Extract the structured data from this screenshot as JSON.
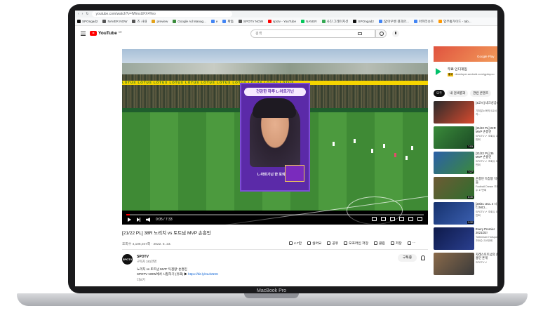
{
  "browser": {
    "url": "youtube.com/watch?v=fWmxUFX4Yeo",
    "bookmarks": [
      {
        "label": "SPOngad2",
        "color": "#111111"
      },
      {
        "label": "NAVER NOW",
        "color": "#555555"
      },
      {
        "label": "즈 사내",
        "color": "#555555"
      },
      {
        "label": "preview",
        "color": "#e3a21a"
      },
      {
        "label": "Google Ad Manag...",
        "color": "#3a8b3a"
      },
      {
        "label": "e",
        "color": "#4285f4"
      },
      {
        "label": "확돔",
        "color": "#4285f4"
      },
      {
        "label": "SPOTV NOW",
        "color": "#555555"
      },
      {
        "label": "spotv - YouTube",
        "color": "#ff0000"
      },
      {
        "label": "NAVER",
        "color": "#03c75a"
      },
      {
        "label": "사진 그레이지션",
        "color": "#34a853"
      },
      {
        "label": "SPOngad2",
        "color": "#111111"
      },
      {
        "label": "[압아우벤 결과안...",
        "color": "#4285f4"
      },
      {
        "label": "아파리슈즈",
        "color": "#4285f4"
      },
      {
        "label": "업무통가이드 - tab...",
        "color": "#ff9800"
      }
    ]
  },
  "youtube": {
    "logo_text": "YouTube",
    "logo_country": "KR",
    "search_placeholder": "검색"
  },
  "video": {
    "board_text": "LOTUS LOTUS LOTUS LOTUS LOTUS LOTUS LOTUS LOTUS LOTUS LOTUS LOTUS",
    "ad_headline": "건강한 하루 L-아르기닌",
    "ad_tagline": "L-아르기닌 한 포의 가치",
    "time_display": "0:05 / 7:33",
    "progress_fraction": 0.012,
    "title": "[21/22 PL] 38R 노리치 vs 토트넘 MVP 손흥민",
    "meta": "조회수 4,106,047회 · 2022. 5. 23.",
    "actions": [
      {
        "label": "4.7만",
        "icon": "thumbs-up-icon"
      },
      {
        "label": "싫어요",
        "icon": "thumbs-down-icon"
      },
      {
        "label": "공유",
        "icon": "share-icon"
      },
      {
        "label": "오프라인 저장",
        "icon": "download-icon"
      },
      {
        "label": "클립",
        "icon": "clip-icon"
      },
      {
        "label": "저장",
        "icon": "save-icon"
      },
      {
        "label": "···",
        "icon": "more-icon"
      }
    ]
  },
  "channel": {
    "avatar_text": "SPOTV",
    "name": "SPOTV",
    "subscribers": "구독자 181만명",
    "subscribe_label": "구독중",
    "desc_line1": "노리치 vs 토트넘 MVP '득점왕' 손흥민",
    "desc_line2_text": "SPOTV NOW에서 시청하기 (유료) ▶ ",
    "desc_line2_link": "https://bit.ly/3LdnN9S",
    "more": "더보기"
  },
  "sidebar": {
    "ad_brand": "Google Play",
    "promo": {
      "title": "무료 인디게임",
      "ad_tag": "광고",
      "url": "developer.android.com/gplay.co"
    },
    "chips": [
      {
        "label": "모두",
        "active": true
      },
      {
        "label": "내 검색결과",
        "active": false
      },
      {
        "label": "관련 콘텐츠",
        "active": false
      }
    ],
    "recommendations": [
      {
        "title": "[4교시] 네크성공!",
        "sub": "기획분노육의 5교시 자...",
        "duration": "",
        "c1": "#2b2b2b",
        "c2": "#d94a2e"
      },
      {
        "title": "[21/22 PL] 22R MVP 손흥민",
        "sub": "SPOTV ✔ 조회수 38만회",
        "duration": "7:53",
        "c1": "#3a8a3a",
        "c2": "#1b4a25"
      },
      {
        "title": "[21/22 PL] 35 MVP 손흥민",
        "sub": "SPOTV ✔ 조회수 56만회",
        "duration": "7:27",
        "c1": "#2b5fa8",
        "c2": "#3b8a3b"
      },
      {
        "title": "손흥민 득점왕 직캠들",
        "sub": "Football Dream 조회수 17만회",
        "duration": "8:30",
        "c1": "#6e5a34",
        "c2": "#2e6e2e"
      },
      {
        "title": "[20/21 UCL 4 시티 MCI...",
        "sub": "SPOTV ✔ 조회수 52만회",
        "duration": "3:32",
        "c1": "#16326e",
        "c2": "#3b5fb0"
      },
      {
        "title": "Every Premier 2021/22!",
        "sub": "Tottenham Hotspur 조회수 210만회",
        "duration": "",
        "c1": "#0e1a4a",
        "c2": "#2a3f8f"
      },
      {
        "title": "자레스토트넘의 손흥민 혼게",
        "sub": "SPOTV ✔",
        "duration": "",
        "c1": "#8a6a4a",
        "c2": "#3a3a3a"
      }
    ]
  },
  "device": {
    "label": "MacBook Pro"
  }
}
